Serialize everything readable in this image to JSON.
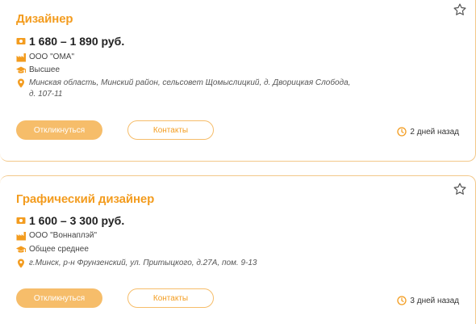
{
  "vacancies": [
    {
      "title": "Дизайнер",
      "salary": "1 680 – 1 890 руб.",
      "company": "ООО \"ОМА\"",
      "education": "Высшее",
      "address": "Минская область, Минский район, сельсовет Щомыслицкий, д. Дворицкая Слобода, д. 107-11",
      "respond_label": "Откликнуться",
      "contacts_label": "Контакты",
      "posted": "2 дней назад"
    },
    {
      "title": "Графический дизайнер",
      "salary": "1 600 – 3 300 руб.",
      "company": "ООО \"Воннаплэй\"",
      "education": "Общее среднее",
      "address": "г.Минск, р-н Фрунзенский, ул. Притыцкого, д.27А, пом. 9-13",
      "respond_label": "Откликнуться",
      "contacts_label": "Контакты",
      "posted": "3 дней назад"
    }
  ],
  "icons": {
    "salary": "money-icon",
    "company": "factory-icon",
    "education": "graduation-cap-icon",
    "address": "location-pin-icon",
    "time": "clock-icon",
    "favorite": "star-icon"
  },
  "colors": {
    "accent": "#f39c1f",
    "button_fill": "#f6bd6a",
    "border": "#f3c88a"
  }
}
